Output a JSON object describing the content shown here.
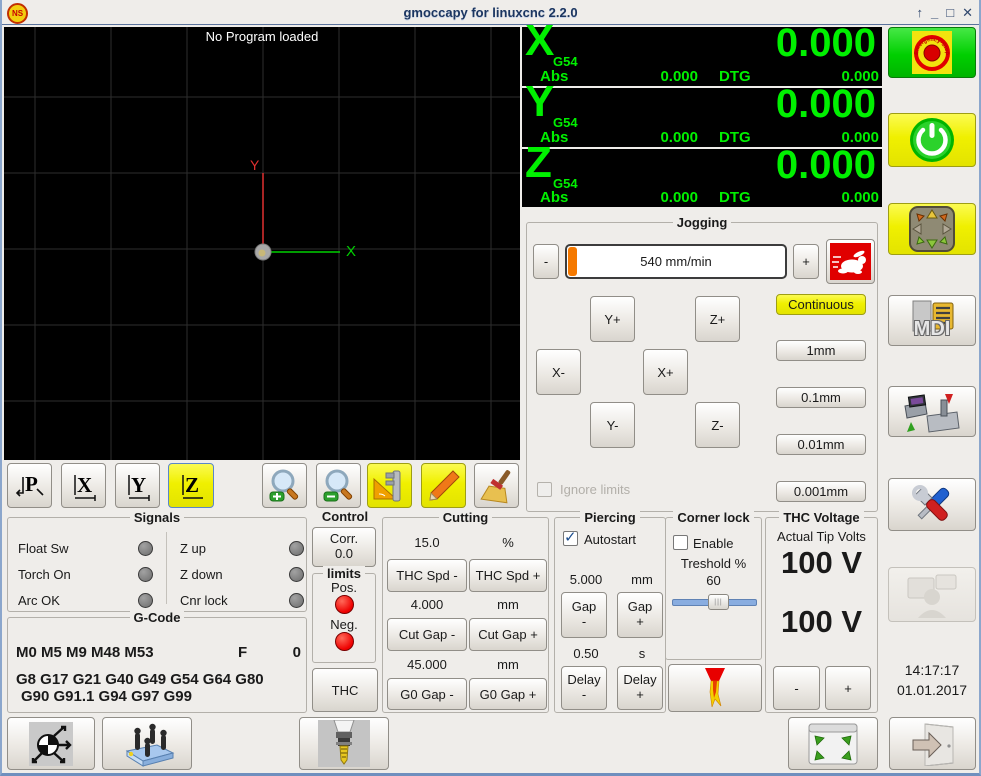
{
  "window": {
    "title": "gmoccapy for linuxcnc  2.2.0",
    "controls": {
      "shade": "↑",
      "minimize": "_",
      "maximize": "□",
      "close": "✕"
    }
  },
  "colors": {
    "dro_green": "#00F000",
    "led_red": "#EE0000",
    "led_gray": "#808080",
    "active_yellow": "#F0F000",
    "estop_green": "#00CF00",
    "rabbit_red": "#E00000",
    "slider_orange": "#F57900",
    "axis_x_green": "#00D000",
    "axis_y_red": "#E03030"
  },
  "preview": {
    "message": "No Program loaded",
    "axis_x_label": "X",
    "axis_y_label": "Y",
    "toolbar": {
      "p": "P",
      "x": "X",
      "y": "Y",
      "z": "Z"
    },
    "toolbar_icons": [
      "view-p-icon",
      "view-x-icon",
      "view-y-icon",
      "view-z-icon",
      "zoom-in-icon",
      "zoom-out-icon",
      "dimensions-icon",
      "draw-path-icon",
      "clear-icon"
    ]
  },
  "dro": {
    "axes": [
      {
        "letter": "X",
        "system": "G54",
        "value": "0.000",
        "abs_label": "Abs",
        "abs_value": "0.000",
        "dtg_label": "DTG",
        "dtg_value": "0.000"
      },
      {
        "letter": "Y",
        "system": "G54",
        "value": "0.000",
        "abs_label": "Abs",
        "abs_value": "0.000",
        "dtg_label": "DTG",
        "dtg_value": "0.000"
      },
      {
        "letter": "Z",
        "system": "G54",
        "value": "0.000",
        "abs_label": "Abs",
        "abs_value": "0.000",
        "dtg_label": "DTG",
        "dtg_value": "0.000"
      }
    ]
  },
  "jogging": {
    "title": "Jogging",
    "speed": "540 mm/min",
    "minus": "-",
    "plus": "+",
    "rabbit_icon": "max-velocity-rabbit-icon",
    "buttons": {
      "y_plus": "Y+",
      "z_plus": "Z+",
      "x_minus": "X-",
      "x_plus": "X+",
      "y_minus": "Y-",
      "z_minus": "Z-"
    },
    "increments": [
      "Continuous",
      "1mm",
      "0.1mm",
      "0.01mm",
      "0.001mm"
    ],
    "ignore_limits": "Ignore limits"
  },
  "signals": {
    "title": "Signals",
    "left": [
      "Float Sw",
      "Torch On",
      "Arc OK"
    ],
    "right": [
      "Z up",
      "Z down",
      "Cnr lock"
    ]
  },
  "gcode": {
    "title": "G-Code",
    "m_codes": "M0 M5 M9 M48 M53",
    "f_label": "F",
    "f_value": "0",
    "g_line1": "G8 G17 G21 G40 G49 G54 G64 G80",
    "g_line2": "G90 G91.1 G94 G97 G99"
  },
  "control": {
    "title": "Control",
    "corr": [
      "Corr.",
      "0.0"
    ],
    "limits_title": "limits",
    "pos": "Pos.",
    "neg": "Neg.",
    "thc": "THC"
  },
  "cutting": {
    "title": "Cutting",
    "rows": [
      {
        "value": "15.0",
        "unit": "%",
        "minus": "THC Spd -",
        "plus": "THC Spd +"
      },
      {
        "value": "4.000",
        "unit": "mm",
        "minus": "Cut Gap -",
        "plus": "Cut Gap +"
      },
      {
        "value": "45.000",
        "unit": "mm",
        "minus": "G0 Gap -",
        "plus": "G0 Gap +"
      }
    ]
  },
  "piercing": {
    "title": "Piercing",
    "autostart": "Autostart",
    "gap_value": "5.000",
    "gap_unit": "mm",
    "gap_minus": [
      "Gap",
      "-"
    ],
    "gap_plus": [
      "Gap",
      "+"
    ],
    "delay_value": "0.50",
    "delay_unit": "s",
    "delay_minus": [
      "Delay",
      "-"
    ],
    "delay_plus": [
      "Delay",
      "+"
    ]
  },
  "corner_lock": {
    "title": "Corner lock",
    "enable": "Enable",
    "threshold_label": "Treshold %",
    "threshold_value": "60"
  },
  "thc_voltage": {
    "title": "THC Voltage",
    "subtitle": "Actual Tip Volts",
    "actual": "100 V",
    "target": "100 V",
    "minus": "-",
    "plus": "+"
  },
  "clock": {
    "time": "14:17:17",
    "date": "01.01.2017"
  },
  "right_column": {
    "mdi_label": "MDI",
    "icons": [
      "emergency-stop-icon",
      "power-icon",
      "jog-pad-icon",
      "mdi-icon",
      "auto-mode-icon",
      "settings-tools-icon",
      "user-mode-icon",
      "exit-icon"
    ]
  },
  "bottom_row": {
    "icons": [
      "touch-off-icon",
      "touch-plate-icon",
      "tool-change-icon",
      "fullscreen-icon",
      "exit-icon"
    ]
  }
}
